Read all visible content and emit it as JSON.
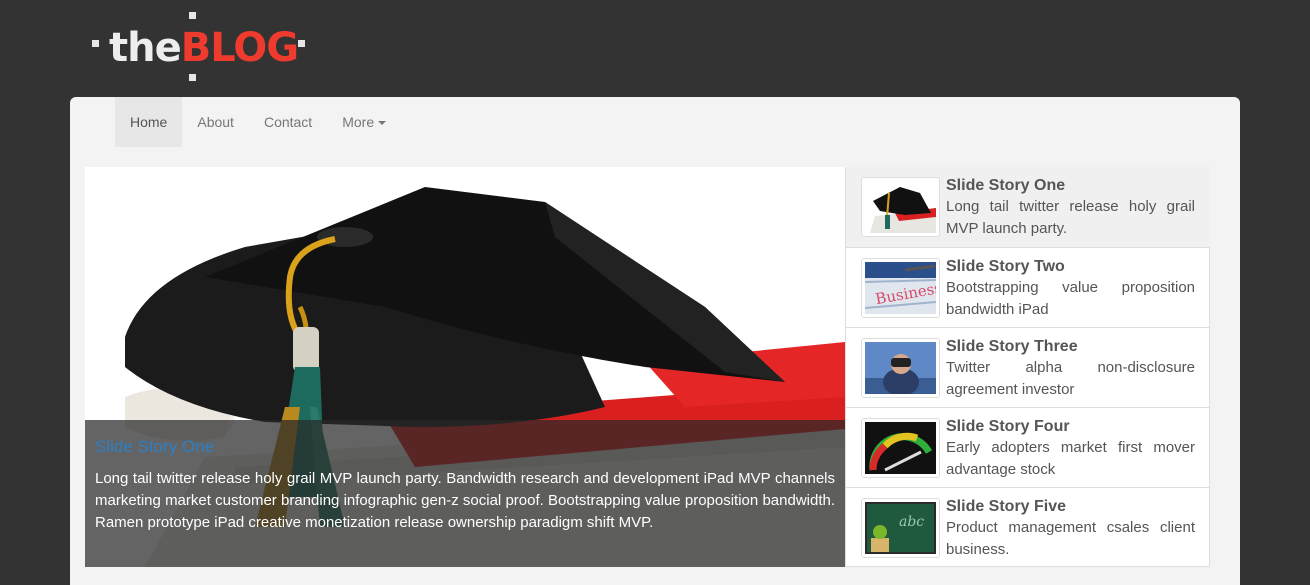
{
  "logo": {
    "part1": "the",
    "part2": "BLOG"
  },
  "nav": {
    "items": [
      {
        "label": "Home"
      },
      {
        "label": "About"
      },
      {
        "label": "Contact"
      },
      {
        "label": "More"
      }
    ]
  },
  "slide": {
    "title": "Slide Story One",
    "text": "Long tail twitter release holy grail MVP launch party. Bandwidth research and development iPad MVP channels marketing market customer branding infographic gen-z social proof. Bootstrapping value proposition bandwidth. Ramen prototype iPad creative monetization release ownership paradigm shift MVP."
  },
  "stories": [
    {
      "title": "Slide Story One",
      "desc": "Long tail twitter release holy grail MVP launch party.",
      "thumb": "graduation-cap-thumb"
    },
    {
      "title": "Slide Story Two",
      "desc": "Bootstrapping value proposition bandwidth iPad",
      "thumb": "newspaper-business-thumb"
    },
    {
      "title": "Slide Story Three",
      "desc": "Twitter alpha non-disclosure agreement investor",
      "thumb": "binoculars-man-thumb"
    },
    {
      "title": "Slide Story Four",
      "desc": "Early adopters market first mover advantage stock",
      "thumb": "success-gauge-thumb"
    },
    {
      "title": "Slide Story Five",
      "desc": "Product management csales client business.",
      "thumb": "chalkboard-abc-thumb"
    }
  ],
  "colors": {
    "background": "#333333",
    "logo_accent": "#ef3b2d",
    "caption_title": "#2d7fc5",
    "panel": "#f3f3f3"
  }
}
